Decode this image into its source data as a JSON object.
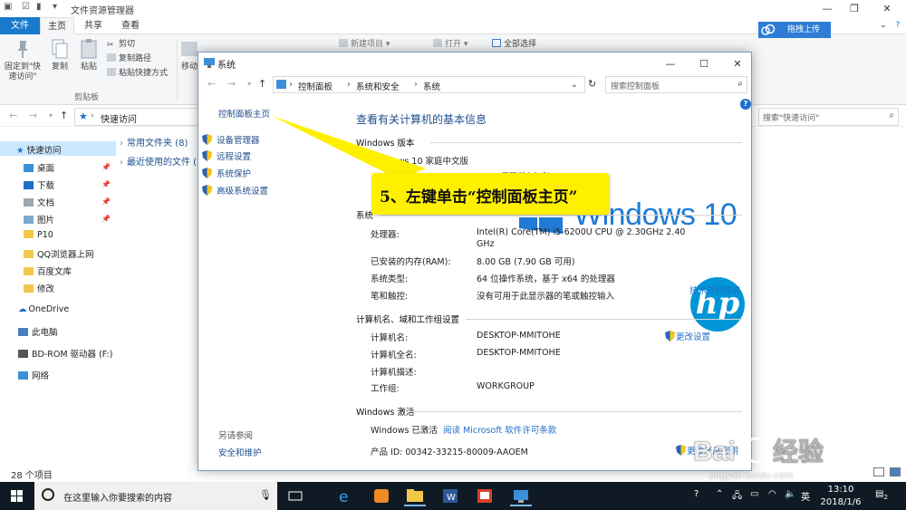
{
  "explorer": {
    "title": "文件资源管理器",
    "tabs": [
      "文件",
      "主页",
      "共享",
      "查看"
    ],
    "ribbon": {
      "pin_label": "固定到\"快\n速访问\"",
      "copy_label": "复制",
      "paste_label": "粘贴",
      "cut_label": "剪切",
      "copy_path_label": "复制路径",
      "paste_shortcut_label": "粘贴快捷方式",
      "clipboard_group": "剪贴板",
      "move_to_label": "移动",
      "new_item_label": "新建项目",
      "open_label": "打开",
      "select_all_label": "全部选择",
      "upload_label": "拖拽上传"
    },
    "address": "快速访问",
    "search_placeholder": "搜索\"快速访问\"",
    "nav": {
      "quick_access": "快速访问",
      "items": [
        "桌面",
        "下载",
        "文档",
        "图片",
        "P10",
        "QQ浏览器上网",
        "百度文库",
        "修改"
      ],
      "onedrive": "OneDrive",
      "this_pc": "此电脑",
      "bd_rom": "BD-ROM 驱动器 (F:)",
      "network": "网络"
    },
    "groups": [
      "常用文件夹 (8)",
      "最近使用的文件 (2"
    ],
    "status": "28 个项目"
  },
  "system_window": {
    "title": "系统",
    "breadcrumb": [
      "控制面板",
      "系统和安全",
      "系统"
    ],
    "search_placeholder": "搜索控制面板",
    "side_links": [
      "控制面板主页",
      "设备管理器",
      "远程设置",
      "系统保护",
      "高级系统设置"
    ],
    "see_also": "另请参阅",
    "security_link": "安全和维护",
    "main_title": "查看有关计算机的基本信息",
    "windows_edition": {
      "heading": "Windows 版本",
      "edition": "Windows 10 家庭中文版",
      "copyright": "© 2017 Microsoft Corporation。保留所有权利。"
    },
    "windows_logo_text": "Windows 10",
    "system": {
      "heading": "系统",
      "rows": [
        {
          "k": "处理器:",
          "v": "Intel(R) Core(TM) i5-6200U CPU @ 2.30GHz   2.40",
          "v2": "GHz"
        },
        {
          "k": "已安装的内存(RAM):",
          "v": "8.00 GB (7.90 GB 可用)"
        },
        {
          "k": "系统类型:",
          "v": "64 位操作系统，基于 x64 的处理器"
        },
        {
          "k": "笔和触控:",
          "v": "没有可用于此显示器的笔或触控输入"
        }
      ],
      "support_link": "技术支持信息",
      "oem_logo": "hp"
    },
    "computer_name": {
      "heading": "计算机名、域和工作组设置",
      "rows": [
        {
          "k": "计算机名:",
          "v": "DESKTOP-MMITOHE"
        },
        {
          "k": "计算机全名:",
          "v": "DESKTOP-MMITOHE"
        },
        {
          "k": "计算机描述:",
          "v": ""
        },
        {
          "k": "工作组:",
          "v": "WORKGROUP"
        }
      ],
      "change_settings": "更改设置"
    },
    "activation": {
      "heading": "Windows 激活",
      "status": "Windows 已激活",
      "license_link": "阅读 Microsoft 软件许可条款",
      "product_id": "产品 ID: 00342-33215-80009-AAOEM",
      "change_key": "更改产品密钥"
    }
  },
  "callout": {
    "text": "5、左键单击“控制面板主页”",
    "color": "#fff000"
  },
  "taskbar": {
    "search_placeholder": "在这里输入你要搜索的内容",
    "ime": "英",
    "time": "13:10",
    "date": "2018/1/6",
    "notifications": "2"
  },
  "watermark": {
    "logo": "Bai度经验",
    "url": "jingyan.baidu.com"
  },
  "colors": {
    "accent": "#1979ca",
    "link": "#1e4e8c",
    "windows_blue": "#1e7bd6",
    "hp_blue": "#0096d6",
    "taskbar": "#101a24"
  }
}
